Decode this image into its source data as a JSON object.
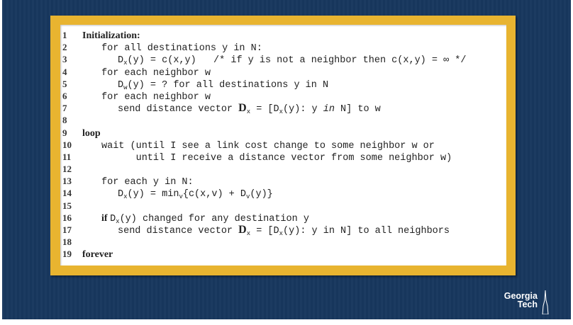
{
  "colors": {
    "background": "#17375e",
    "frame": "#e8b430",
    "paper": "#ffffff"
  },
  "logo": {
    "line1": "Georgia",
    "line2": "Tech"
  },
  "code_lines": [
    {
      "num": "1",
      "indent": 0,
      "parts": [
        {
          "t": "Initialization:",
          "c": "kw"
        }
      ]
    },
    {
      "num": "2",
      "indent": 1,
      "parts": [
        {
          "t": "for all destinations y in N:",
          "c": "mono"
        }
      ]
    },
    {
      "num": "3",
      "indent": 2,
      "parts": [
        {
          "t": "D",
          "c": "mono"
        },
        {
          "t": "x",
          "c": "sub"
        },
        {
          "t": "(y) = c(x,y)   /* if y is not a neighbor then c(x,y) = ∞ */",
          "c": "mono"
        }
      ]
    },
    {
      "num": "4",
      "indent": 1,
      "parts": [
        {
          "t": "for each neighbor w",
          "c": "mono"
        }
      ]
    },
    {
      "num": "5",
      "indent": 2,
      "parts": [
        {
          "t": "D",
          "c": "mono"
        },
        {
          "t": "w",
          "c": "sub"
        },
        {
          "t": "(y) = ? for all destinations y in N",
          "c": "mono"
        }
      ]
    },
    {
      "num": "6",
      "indent": 1,
      "parts": [
        {
          "t": "for each neighbor w",
          "c": "mono"
        }
      ]
    },
    {
      "num": "7",
      "indent": 2,
      "parts": [
        {
          "t": "send distance vector ",
          "c": "mono"
        },
        {
          "t": "D",
          "c": "big"
        },
        {
          "t": "x",
          "c": "sub"
        },
        {
          "t": " = [D",
          "c": "mono"
        },
        {
          "t": "x",
          "c": "sub"
        },
        {
          "t": "(y): y ",
          "c": "mono"
        },
        {
          "t": "in",
          "c": "it"
        },
        {
          "t": " N] to w",
          "c": "mono"
        }
      ]
    },
    {
      "num": "8",
      "indent": 0,
      "parts": []
    },
    {
      "num": "9",
      "indent": 0,
      "parts": [
        {
          "t": "loop",
          "c": "kw"
        }
      ]
    },
    {
      "num": "10",
      "indent": 1,
      "parts": [
        {
          "t": "wait (until I see a link cost change to some neighbor w or",
          "c": "mono"
        }
      ]
    },
    {
      "num": "11",
      "indent": 1,
      "parts": [
        {
          "t": "      until I receive a distance vector from some neighbor w)",
          "c": "mono"
        }
      ]
    },
    {
      "num": "12",
      "indent": 0,
      "parts": []
    },
    {
      "num": "13",
      "indent": 1,
      "parts": [
        {
          "t": "for each y in N:",
          "c": "mono"
        }
      ]
    },
    {
      "num": "14",
      "indent": 2,
      "parts": [
        {
          "t": "D",
          "c": "mono"
        },
        {
          "t": "x",
          "c": "sub"
        },
        {
          "t": "(y) = min",
          "c": "mono"
        },
        {
          "t": "v",
          "c": "sub"
        },
        {
          "t": "{c(x,v) + D",
          "c": "mono"
        },
        {
          "t": "v",
          "c": "sub"
        },
        {
          "t": "(y)}",
          "c": "mono"
        }
      ]
    },
    {
      "num": "15",
      "indent": 0,
      "parts": []
    },
    {
      "num": "16",
      "indent": 1,
      "parts": [
        {
          "t": "if ",
          "c": "kw"
        },
        {
          "t": "D",
          "c": "mono"
        },
        {
          "t": "x",
          "c": "sub"
        },
        {
          "t": "(y) changed for any destination y",
          "c": "mono"
        }
      ]
    },
    {
      "num": "17",
      "indent": 2,
      "parts": [
        {
          "t": "send distance vector ",
          "c": "mono"
        },
        {
          "t": "D",
          "c": "big"
        },
        {
          "t": "x",
          "c": "sub"
        },
        {
          "t": " = [D",
          "c": "mono"
        },
        {
          "t": "x",
          "c": "sub"
        },
        {
          "t": "(y): y in N] to all neighbors",
          "c": "mono"
        }
      ]
    },
    {
      "num": "18",
      "indent": 0,
      "parts": []
    },
    {
      "num": "19",
      "indent": 0,
      "parts": [
        {
          "t": "forever",
          "c": "kw"
        }
      ]
    }
  ]
}
